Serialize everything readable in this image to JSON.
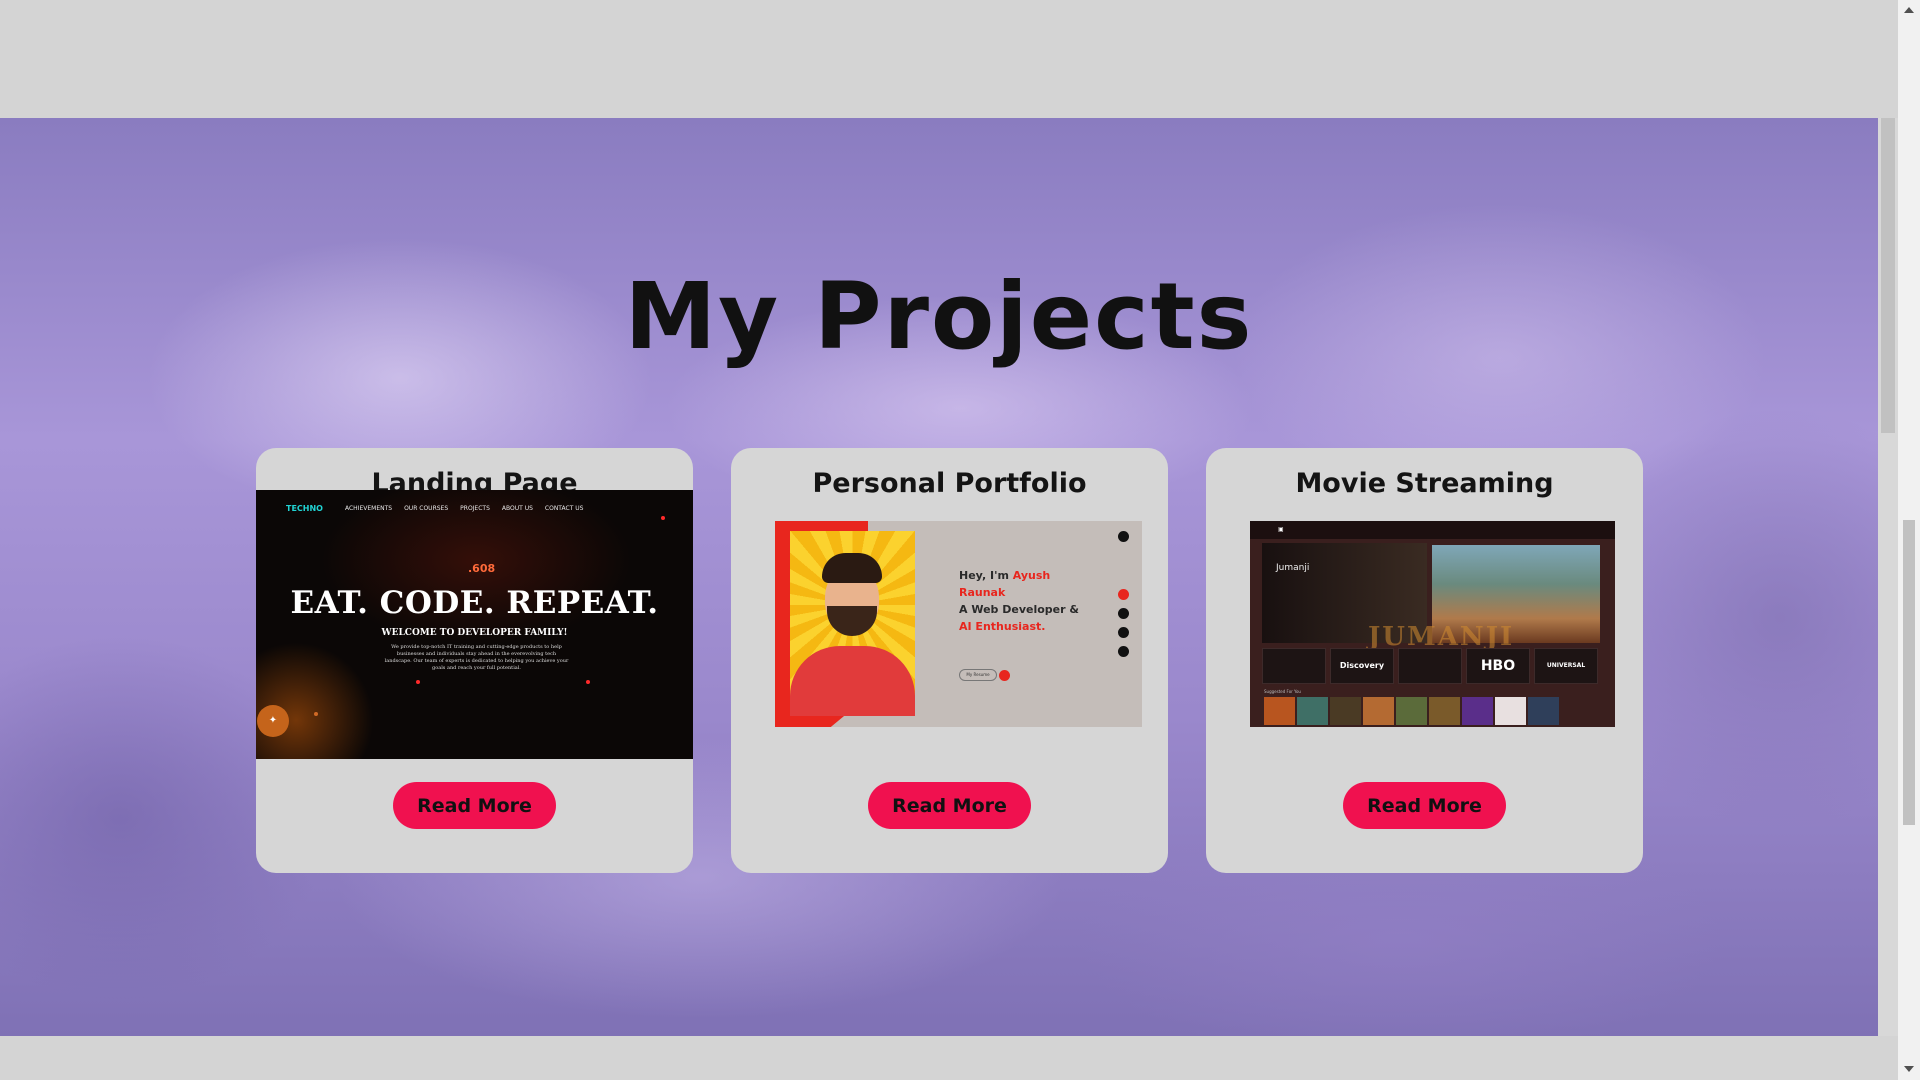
{
  "section": {
    "title": "My Projects"
  },
  "projects": [
    {
      "title": "Landing Page",
      "button": "Read More",
      "preview": {
        "logo": "TECHNO",
        "nav": [
          "ACHIEVEMENTS",
          "OUR COURSES",
          "PROJECTS",
          "ABOUT US",
          "CONTACT US"
        ],
        "counter": ".608",
        "hero": "EAT. CODE. REPEAT.",
        "subtitle": "WELCOME TO DEVELOPER FAMILY!",
        "body": "We provide top-notch IT training and cutting-edge products to help businesses and individuals stay ahead in the everevolving tech landscape. Our team of experts is dedicated to helping you achieve your goals and reach your full potential."
      }
    },
    {
      "title": "Personal Portfolio",
      "button": "Read More",
      "preview": {
        "greeting": "Hey, I'm ",
        "name": "Ayush Raunak",
        "role_line1": "A Web Developer &",
        "role_line2": "AI Enthusiast.",
        "resume": "My Resume"
      }
    },
    {
      "title": "Movie Streaming",
      "button": "Read More",
      "preview": {
        "featured": "Jumanji",
        "poster_word": "JUMANJI",
        "brands": [
          "",
          "Discovery",
          "",
          "HBO",
          "UNIVERSAL"
        ],
        "suggested": "Suggested For You"
      }
    }
  ],
  "colors": {
    "accent": "#f0114f",
    "card_bg": "#d6d6d6",
    "page_bg": "#d4d4d4"
  }
}
